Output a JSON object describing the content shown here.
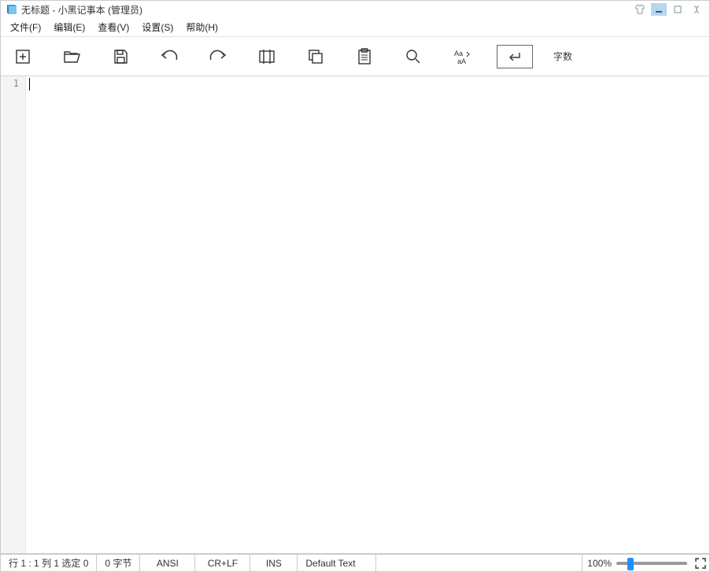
{
  "titlebar": {
    "title": "无标题 - 小黑记事本 (管理员)"
  },
  "menu": {
    "file": "文件(F)",
    "edit": "编辑(E)",
    "view": "查看(V)",
    "settings": "设置(S)",
    "help": "帮助(H)"
  },
  "toolbar": {
    "word_count_label": "字数"
  },
  "editor": {
    "line_number": "1",
    "content": ""
  },
  "statusbar": {
    "position": "行 1 : 1  列 1  选定 0",
    "size": "0 字节",
    "encoding": "ANSI",
    "line_ending": "CR+LF",
    "insert_mode": "INS",
    "language": "Default Text",
    "zoom": "100%"
  }
}
